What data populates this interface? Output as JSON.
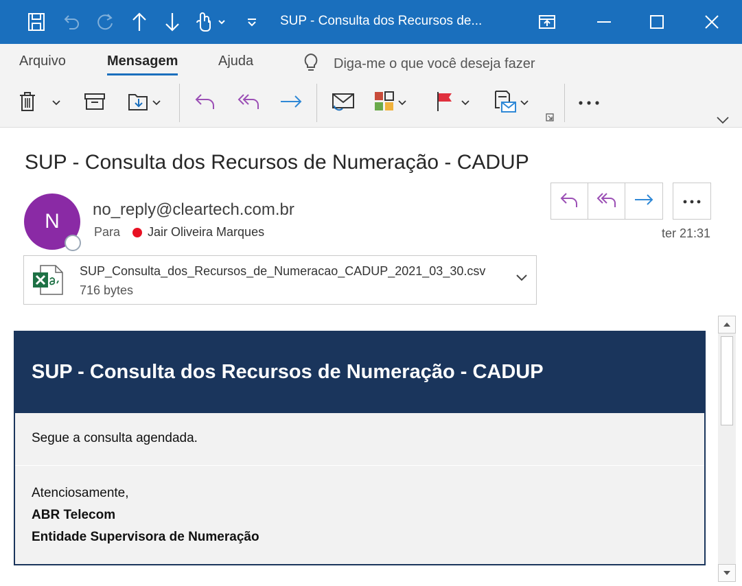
{
  "window": {
    "title": "SUP - Consulta dos Recursos de...",
    "accent_color": "#1a6fbd",
    "quick_access_icons": [
      "save-icon",
      "undo-icon",
      "redo-icon",
      "up-arrow-icon",
      "down-arrow-icon",
      "touch-mode-icon",
      "customize-toolbar-icon"
    ],
    "controls": [
      "restore-ribbon-icon",
      "minimize-icon",
      "maximize-icon",
      "close-icon"
    ]
  },
  "ribbon": {
    "tabs": [
      {
        "label": "Arquivo",
        "active": false
      },
      {
        "label": "Mensagem",
        "active": true
      },
      {
        "label": "Ajuda",
        "active": false
      }
    ],
    "tell_me": "Diga-me o que você deseja fazer",
    "tools": [
      "delete-icon",
      "archive-icon",
      "move-icon",
      "reply-icon",
      "reply-all-icon",
      "forward-icon",
      "read-unread-icon",
      "categorize-icon",
      "flag-icon",
      "rules-icon",
      "more-icon"
    ]
  },
  "message": {
    "subject": "SUP - Consulta dos Recursos de Numeração - CADUP",
    "avatar_initial": "N",
    "avatar_color": "#8a2aa5",
    "sender": "no_reply@cleartech.com.br",
    "to_label": "Para",
    "to_name": "Jair Oliveira Marques",
    "time": "ter 21:31",
    "attachment": {
      "name": "SUP_Consulta_dos_Recursos_de_Numeracao_CADUP_2021_03_30.csv",
      "size": "716 bytes"
    }
  },
  "body": {
    "header": "SUP - Consulta dos Recursos de Numeração - CADUP",
    "header_color": "#1a355c",
    "line1": "Segue a consulta agendada.",
    "closing": "Atenciosamente,",
    "org": "ABR Telecom",
    "dept": "Entidade Supervisora de Numeração"
  }
}
